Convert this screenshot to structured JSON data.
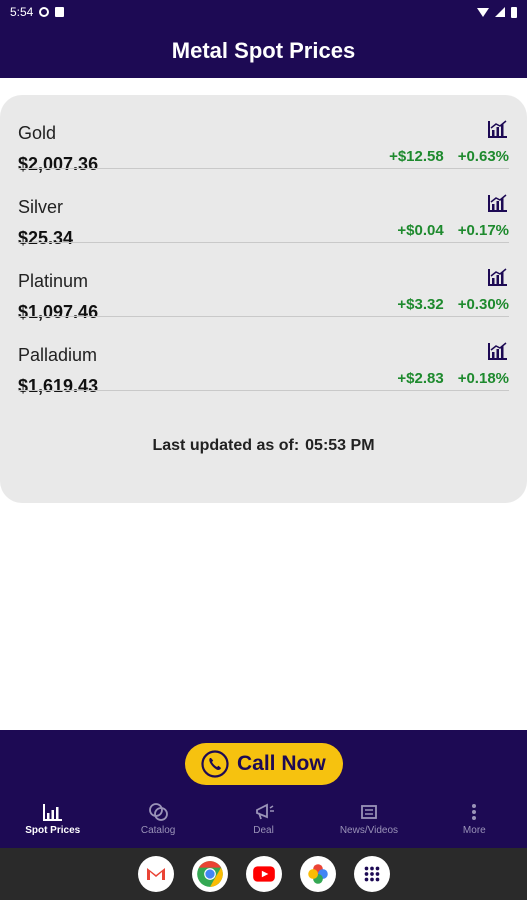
{
  "status_bar": {
    "time": "5:54"
  },
  "app": {
    "title": "Metal Spot Prices"
  },
  "metals": [
    {
      "name": "Gold",
      "price": "$2,007.36",
      "change": "+$12.58",
      "percent": "+0.63%"
    },
    {
      "name": "Silver",
      "price": "$25.34",
      "change": "+$0.04",
      "percent": "+0.17%"
    },
    {
      "name": "Platinum",
      "price": "$1,097.46",
      "change": "+$3.32",
      "percent": "+0.30%"
    },
    {
      "name": "Palladium",
      "price": "$1,619.43",
      "change": "+$2.83",
      "percent": "+0.18%"
    }
  ],
  "last_updated": {
    "label": "Last updated as of:",
    "time": "05:53 PM"
  },
  "call_button": {
    "label": "Call Now"
  },
  "nav": [
    {
      "label": "Spot Prices",
      "icon": "bar-chart-icon",
      "active": true
    },
    {
      "label": "Catalog",
      "icon": "coins-icon",
      "active": false
    },
    {
      "label": "Deal",
      "icon": "megaphone-icon",
      "active": false
    },
    {
      "label": "News/Videos",
      "icon": "news-icon",
      "active": false
    },
    {
      "label": "More",
      "icon": "more-vert-icon",
      "active": false
    }
  ],
  "dock": [
    "gmail-icon",
    "chrome-icon",
    "youtube-icon",
    "photos-icon",
    "apps-icon"
  ],
  "colors": {
    "primary": "#1d0a54",
    "accent": "#f6c20f",
    "positive": "#1e8a2e",
    "card": "#e9e9e9"
  }
}
